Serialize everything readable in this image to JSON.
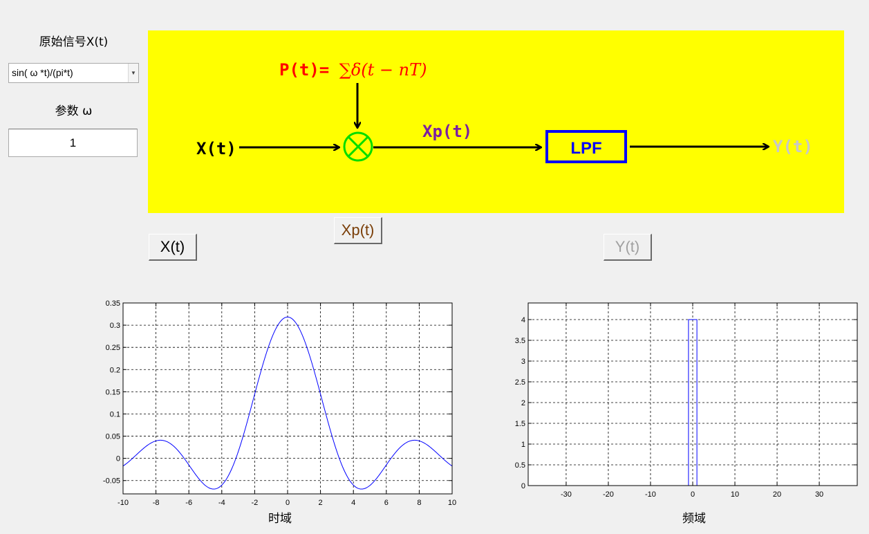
{
  "controls": {
    "signal_label": "原始信号X(t)",
    "signal_select": "sin( ω *t)/(pi*t)",
    "param_label": "参数 ω",
    "param_value": "1"
  },
  "diagram": {
    "pt_prefix": "P(t)= ",
    "pt_formula": "∑δ(t − nT)",
    "x_label": "X(t)",
    "xp_label": "Xp(t)",
    "lpf_label": "LPF",
    "y_label": "Y(t)",
    "colors": {
      "background": "#ffff00",
      "pt": "#ff0000",
      "xp": "#7b1fa2",
      "lpf_border": "#0000ff",
      "multiplier": "#00dd00",
      "y": "#c8c8c8"
    }
  },
  "buttons": {
    "x_btn": "X(t)",
    "xp_btn": "Xp(t)",
    "y_btn": "Y(t)",
    "y_enabled": false
  },
  "charts": {
    "time_xlabel": "时域",
    "freq_xlabel": "频域"
  },
  "chart_data": [
    {
      "type": "line",
      "title": "",
      "xlabel": "时域",
      "ylabel": "",
      "xlim": [
        -10,
        10
      ],
      "ylim": [
        -0.08,
        0.35
      ],
      "xticks": [
        -10,
        -8,
        -6,
        -4,
        -2,
        0,
        2,
        4,
        6,
        8,
        10
      ],
      "yticks": [
        -0.05,
        0,
        0.05,
        0.1,
        0.15,
        0.2,
        0.25,
        0.3,
        0.35
      ],
      "grid": true,
      "function": "sin(t)/(pi*t)",
      "x": [
        -10,
        -9,
        -8,
        -7.725,
        -7,
        -6,
        -5,
        -4.493,
        -4,
        -3,
        -2,
        -1,
        0,
        1,
        2,
        3,
        4,
        4.493,
        5,
        6,
        7,
        7.725,
        8,
        9,
        10
      ],
      "y": [
        -0.0173,
        0.0146,
        0.0394,
        0.0411,
        0.0299,
        -0.0148,
        -0.061,
        -0.0689,
        -0.0602,
        0.015,
        0.1447,
        0.2678,
        0.3183,
        0.2678,
        0.1447,
        0.015,
        -0.0602,
        -0.0689,
        -0.061,
        -0.0148,
        0.0299,
        0.0411,
        0.0394,
        0.0146,
        -0.0173
      ],
      "color": "#0000ff"
    },
    {
      "type": "line",
      "title": "",
      "xlabel": "频域",
      "ylabel": "",
      "xlim": [
        -39,
        39
      ],
      "ylim": [
        0,
        4.4
      ],
      "xticks": [
        -30,
        -20,
        -10,
        0,
        10,
        20,
        30
      ],
      "yticks": [
        0,
        0.5,
        1,
        1.5,
        2,
        2.5,
        3,
        3.5,
        4
      ],
      "grid": true,
      "x": [
        -39,
        -1,
        -1,
        1,
        1,
        39
      ],
      "y": [
        0,
        0,
        4,
        4,
        0,
        0
      ],
      "color": "#0000ff"
    }
  ]
}
